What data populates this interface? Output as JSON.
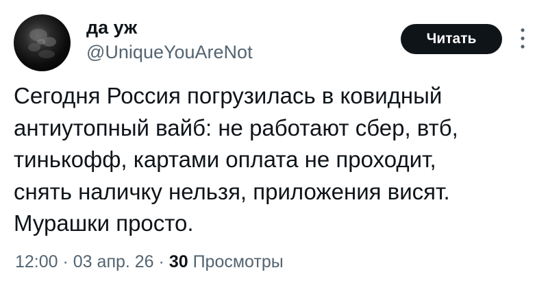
{
  "author": {
    "name": "да уж",
    "handle": "@UniqueYouAreNot"
  },
  "actions": {
    "follow_label": "Читать",
    "more_icon": "more-vertical-icon"
  },
  "tweet": {
    "lines": [
      "Сегодня Россия погрузилась в ковидный",
      "антиутопный вайб: не работают сбер, втб,",
      "тинькофф, картами оплата не проходит,",
      "снять наличку нельзя, приложения висят.",
      "Мурашки просто."
    ]
  },
  "meta": {
    "time": "12:00",
    "separator": " · ",
    "date": "03 апр. 26",
    "views_count": "30",
    "views_label": "Просмотры"
  },
  "colors": {
    "text": "#0f1419",
    "secondary": "#536471",
    "button_bg": "#0f1419",
    "button_text": "#ffffff",
    "background": "#ffffff"
  }
}
